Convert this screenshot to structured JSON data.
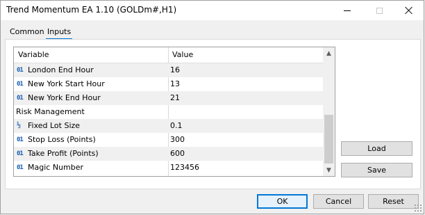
{
  "window": {
    "title": "Trend Momentum EA 1.10 (GOLDm#,H1)"
  },
  "tabs": [
    {
      "label": "Common",
      "active": false
    },
    {
      "label": "Inputs",
      "active": true
    }
  ],
  "grid": {
    "headers": {
      "variable": "Variable",
      "value": "Value"
    },
    "rows": [
      {
        "icon": "01",
        "variable": "London End Hour",
        "value": "16"
      },
      {
        "icon": "01",
        "variable": "New York Start Hour",
        "value": "13"
      },
      {
        "icon": "01",
        "variable": "New York End Hour",
        "value": "21"
      },
      {
        "icon": "",
        "variable": "Risk Management",
        "value": ""
      },
      {
        "icon": "½",
        "variable": "Fixed Lot Size",
        "value": "0.1"
      },
      {
        "icon": "01",
        "variable": "Stop Loss (Points)",
        "value": "300"
      },
      {
        "icon": "01",
        "variable": "Take Profit (Points)",
        "value": "600"
      },
      {
        "icon": "01",
        "variable": "Magic Number",
        "value": "123456"
      }
    ]
  },
  "side_buttons": {
    "load": "Load",
    "save": "Save"
  },
  "footer_buttons": {
    "ok": "OK",
    "cancel": "Cancel",
    "reset": "Reset"
  },
  "colors": {
    "accent": "#0078d7",
    "icon_blue": "#1a5fb4",
    "row_shade": "#f0f0f0"
  }
}
